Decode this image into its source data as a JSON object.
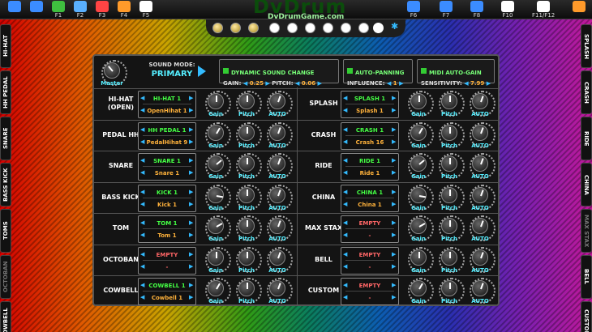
{
  "toolbar": {
    "left": [
      {
        "icon": "back-icon"
      },
      {
        "icon": "save-icon"
      },
      {
        "icon": "kit-icon",
        "key": "F1"
      },
      {
        "icon": "keyboard-icon",
        "key": "F2"
      },
      {
        "icon": "xt-icon",
        "key": "F3"
      },
      {
        "icon": "music-icon",
        "key": "F4"
      },
      {
        "icon": "metronome-icon",
        "key": "F5"
      }
    ],
    "right": [
      {
        "icon": "drum-icon",
        "key": "F6"
      },
      {
        "icon": "headphones-icon",
        "key": "F7"
      },
      {
        "icon": "record-icon",
        "key": "F8"
      },
      {
        "icon": "mixer-icon",
        "key": "F10"
      },
      {
        "icon": "fullscreen-icon",
        "key": "F11/F12"
      },
      {
        "icon": "exit-icon"
      }
    ]
  },
  "logo": {
    "title": "DvDrum",
    "subtitle": "DvDrumGame.com"
  },
  "left_tabs": [
    "HI-HAT",
    "HH PEDAL",
    "SNARE",
    "BASS KICK",
    "TOMS",
    "OCTOBAN",
    "COWBELL"
  ],
  "right_tabs": [
    "SPLASH",
    "CRASH",
    "RIDE",
    "CHINA",
    "MAX STAX",
    "BELL",
    "CUSTOM"
  ],
  "header": {
    "master_label": "Master",
    "sound_mode_label": "SOUND MODE:",
    "sound_mode_value": "PRIMARY",
    "dynamic_title": "DYNAMIC SOUND CHANGE",
    "gain_label": "GAIN:",
    "gain_value": "0.25",
    "pitch_label": "PITCH:",
    "pitch_value": "0.06",
    "autopan_title": "AUTO-PANNING",
    "influence_label": "INFLUENCE:",
    "influence_value": "1",
    "midi_title": "MIDI AUTO-GAIN",
    "sensitivity_label": "SENSITIVITY:",
    "sensitivity_value": "7.99"
  },
  "knob_labels": {
    "gain": "Gain",
    "pitch": "Pitch",
    "auto": "AUTO"
  },
  "left_rows": [
    {
      "name": "HI-HAT\n(OPEN)",
      "sel1": "HI-HAT 1",
      "sel2": "OpenHihat 1",
      "empty": false
    },
    {
      "name": "PEDAL HH",
      "sel1": "HH PEDAL 1",
      "sel2": "PedalHihat 9",
      "empty": false
    },
    {
      "name": "SNARE",
      "sel1": "SNARE 1",
      "sel2": "Snare 1",
      "empty": false
    },
    {
      "name": "BASS KICK",
      "sel1": "KICK 1",
      "sel2": "Kick 1",
      "empty": false
    },
    {
      "name": "TOM",
      "sel1": "TOM 1",
      "sel2": "Tom 1",
      "empty": false
    },
    {
      "name": "OCTOBAN",
      "sel1": "EMPTY",
      "sel2": "-",
      "empty": true
    },
    {
      "name": "COWBELL",
      "sel1": "COWBELL 1",
      "sel2": "Cowbell 1",
      "empty": false
    }
  ],
  "right_rows": [
    {
      "name": "SPLASH",
      "sel1": "SPLASH 1",
      "sel2": "Splash 1",
      "empty": false
    },
    {
      "name": "CRASH",
      "sel1": "CRASH 1",
      "sel2": "Crash 16",
      "empty": false
    },
    {
      "name": "RIDE",
      "sel1": "RIDE 1",
      "sel2": "Ride 1",
      "empty": false
    },
    {
      "name": "CHINA",
      "sel1": "CHINA 1",
      "sel2": "China 1",
      "empty": false
    },
    {
      "name": "MAX STAX",
      "sel1": "EMPTY",
      "sel2": "-",
      "empty": true
    },
    {
      "name": "BELL",
      "sel1": "EMPTY",
      "sel2": "-",
      "empty": true
    },
    {
      "name": "CUSTOM",
      "sel1": "EMPTY",
      "sel2": "-",
      "empty": true
    }
  ]
}
